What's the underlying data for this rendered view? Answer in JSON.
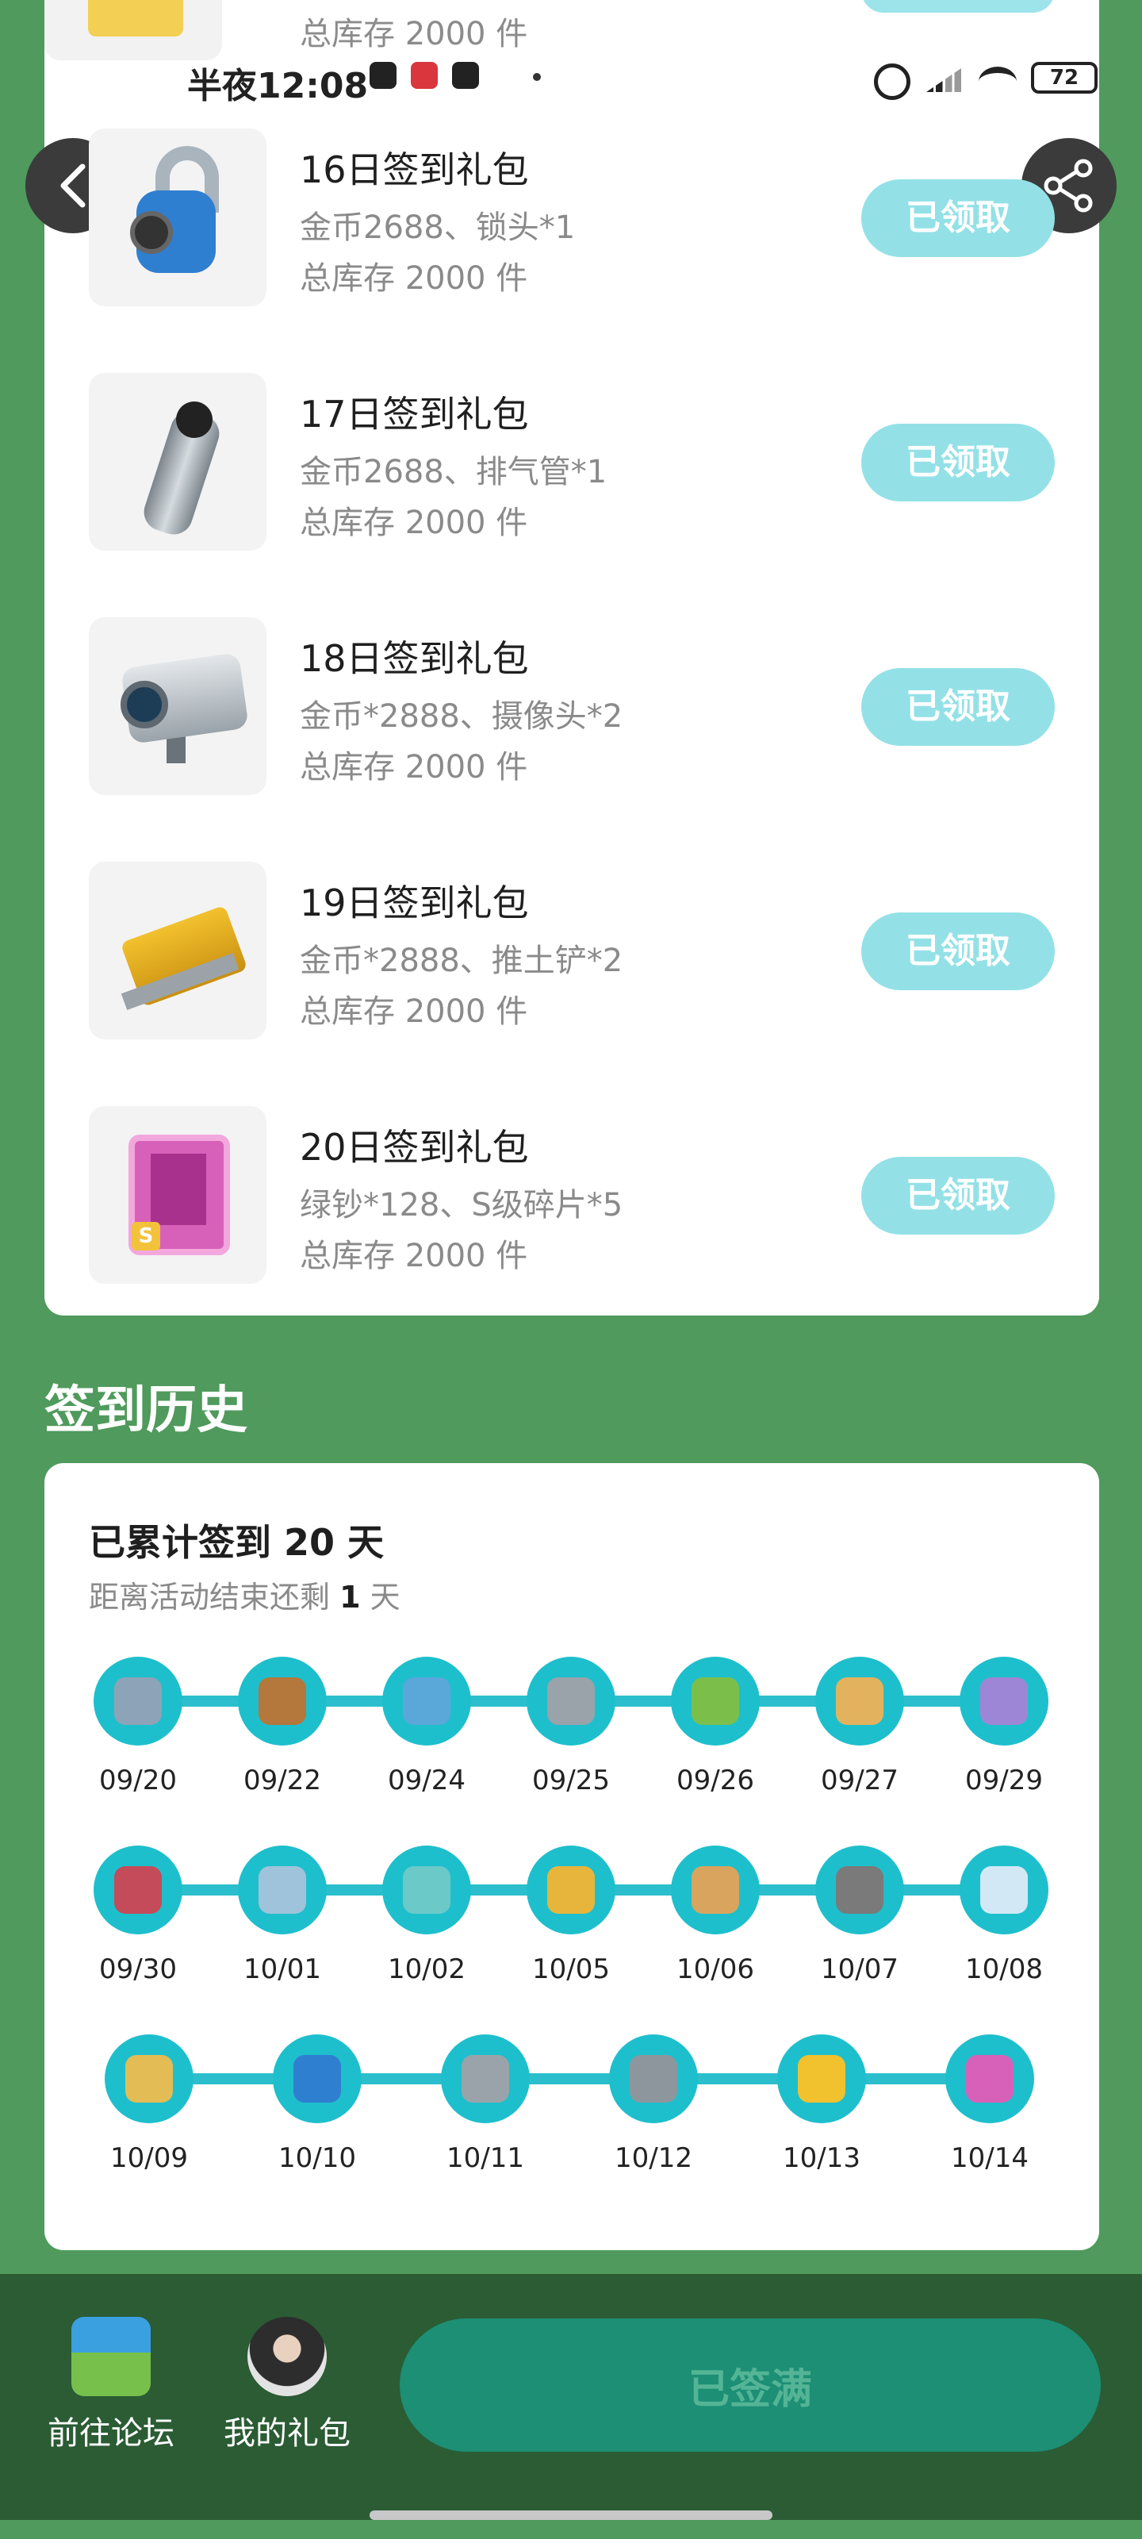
{
  "status_bar": {
    "time": "半夜12:08",
    "battery": "72"
  },
  "prev_item": {
    "stock": "总库存 2000 件"
  },
  "gifts": [
    {
      "title": "16日签到礼包",
      "desc": "金币2688、锁头*1",
      "stock": "总库存 2000 件",
      "button": "已领取",
      "icon": "padlock-icon"
    },
    {
      "title": "17日签到礼包",
      "desc": "金币2688、排气管*1",
      "stock": "总库存 2000 件",
      "button": "已领取",
      "icon": "exhaust-pipe-icon"
    },
    {
      "title": "18日签到礼包",
      "desc": "金币*2888、摄像头*2",
      "stock": "总库存 2000 件",
      "button": "已领取",
      "icon": "camera-icon"
    },
    {
      "title": "19日签到礼包",
      "desc": "金币*2888、推土铲*2",
      "stock": "总库存 2000 件",
      "button": "已领取",
      "icon": "bulldozer-blade-icon"
    },
    {
      "title": "20日签到礼包",
      "desc": "绿钞*128、S级碎片*5",
      "stock": "总库存 2000 件",
      "button": "已领取",
      "icon": "s-card-icon"
    }
  ],
  "history": {
    "heading": "签到历史",
    "total_prefix": "已累计签到 ",
    "total_days": "20",
    "total_suffix": " 天",
    "remain_prefix": "距离活动结束还剩 ",
    "remain_days": "1",
    "remain_suffix": " 天",
    "rows": [
      [
        "09/20",
        "09/22",
        "09/24",
        "09/25",
        "09/26",
        "09/27",
        "09/29"
      ],
      [
        "09/30",
        "10/01",
        "10/02",
        "10/05",
        "10/06",
        "10/07",
        "10/08"
      ],
      [
        "10/09",
        "10/10",
        "10/11",
        "10/12",
        "10/13",
        "10/14"
      ]
    ]
  },
  "bottom": {
    "forum_label": "前往论坛",
    "gift_label": "我的礼包",
    "signed_label": "已签满"
  },
  "colors": {
    "background": "#4f9a5c",
    "button_claimed": "#93e1e7",
    "timeline": "#1ebfcc",
    "bottom_bar": "#2b5c34",
    "signed_button": "#1c8f75"
  }
}
